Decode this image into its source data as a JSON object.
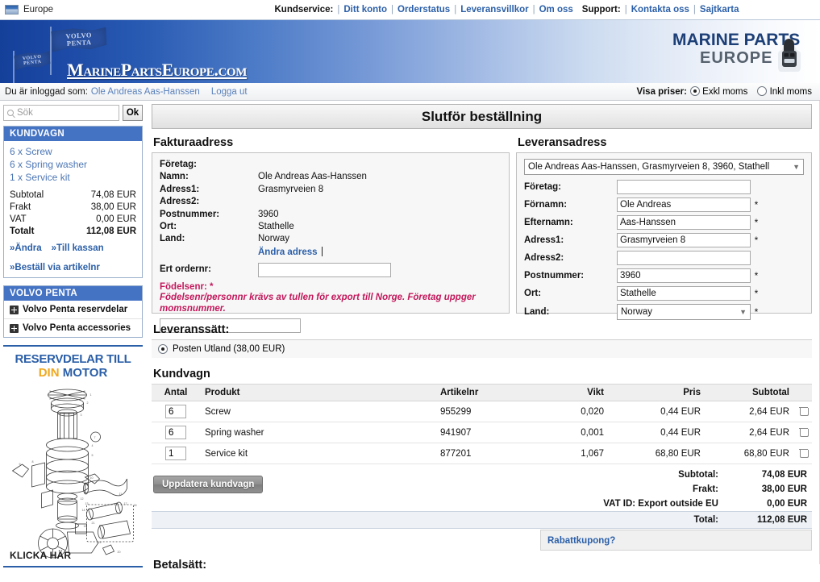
{
  "topbar": {
    "region": "Europe",
    "customer_service_label": "Kundservice:",
    "customer_links": [
      "Ditt konto",
      "Orderstatus",
      "Leveransvillkor",
      "Om oss"
    ],
    "support_label": "Support:",
    "support_links": [
      "Kontakta oss",
      "Sajtkarta"
    ]
  },
  "masthead": {
    "flag_text_line1": "VOLVO",
    "flag_text_line2": "PENTA",
    "wordmark": "MarinePartsEurope.com",
    "logo_line1": "MARINE PARTS",
    "logo_line2": "EUROPE"
  },
  "loginbar": {
    "logged_in_label": "Du är inloggad som:",
    "user_name": "Ole Andreas Aas-Hanssen",
    "logout_label": "Logga ut",
    "show_prices_label": "Visa priser:",
    "price_option_excl": "Exkl moms",
    "price_option_incl": "Inkl moms",
    "price_selected": "Exkl moms"
  },
  "sidebar": {
    "search_placeholder": "Sök",
    "search_value": "",
    "search_button": "Ok",
    "cart_panel": {
      "title": "KUNDVAGN",
      "lines": [
        "6 x Screw",
        "6 x Spring washer",
        "1 x Service kit"
      ],
      "totals": [
        {
          "label": "Subtotal",
          "value": "74,08 EUR"
        },
        {
          "label": "Frakt",
          "value": "38,00 EUR"
        },
        {
          "label": "VAT",
          "value": "0,00 EUR"
        },
        {
          "label": "Totalt",
          "value": "112,08 EUR"
        }
      ],
      "action_edit": "»Ändra",
      "action_checkout": "»Till kassan",
      "action_order_by_partno": "»Beställ via artikelnr"
    },
    "volvo_panel": {
      "title": "VOLVO PENTA",
      "items": [
        {
          "label": "Volvo Penta reservdelar"
        },
        {
          "label": "Volvo Penta accessories"
        }
      ]
    },
    "promo": {
      "line1": "RESERVDELAR TILL",
      "line2_a": "DIN",
      "line2_b": "MOTOR",
      "cta": "KLICKA HÄR"
    }
  },
  "main": {
    "page_title": "Slutför beställning",
    "billing": {
      "heading": "Fakturaadress",
      "rows": [
        {
          "label": "Företag:",
          "value": ""
        },
        {
          "label": "Namn:",
          "value": "Ole Andreas Aas-Hanssen"
        },
        {
          "label": "Adress1:",
          "value": "Grasmyrveien 8"
        },
        {
          "label": "Adress2:",
          "value": ""
        },
        {
          "label": "Postnummer:",
          "value": "3960"
        },
        {
          "label": "Ort:",
          "value": "Stathelle"
        },
        {
          "label": "Land:",
          "value": "Norway"
        }
      ],
      "change_address_link": "Ändra adress",
      "order_no_label": "Ert ordernr:",
      "order_no_value": "",
      "birth_label": "Födelsenr: *",
      "birth_warning": "Födelsenr/personnr krävs av tullen för export till Norge. Företag uppger momsnummer.",
      "birth_value": ""
    },
    "delivery": {
      "heading": "Leveransadress",
      "selected_address": "Ole Andreas Aas-Hanssen, Grasmyrveien 8, 3960, Stathell",
      "fields": [
        {
          "label": "Företag:",
          "value": "",
          "required": "",
          "type": "text"
        },
        {
          "label": "Förnamn:",
          "value": "Ole Andreas",
          "required": "*",
          "type": "text"
        },
        {
          "label": "Efternamn:",
          "value": "Aas-Hanssen",
          "required": "*",
          "type": "text"
        },
        {
          "label": "Adress1:",
          "value": "Grasmyrveien 8",
          "required": "*",
          "type": "text"
        },
        {
          "label": "Adress2:",
          "value": "",
          "required": "",
          "type": "text"
        },
        {
          "label": "Postnummer:",
          "value": "3960",
          "required": "*",
          "type": "text"
        },
        {
          "label": "Ort:",
          "value": "Stathelle",
          "required": "*",
          "type": "text"
        },
        {
          "label": "Land:",
          "value": "Norway",
          "required": "*",
          "type": "select"
        }
      ]
    },
    "shipping": {
      "heading": "Leveranssätt:",
      "option_label": "Posten Utland (38,00 EUR)",
      "selected": true
    },
    "cart": {
      "heading": "Kundvagn",
      "columns": [
        "Antal",
        "Produkt",
        "Artikelnr",
        "Vikt",
        "Pris",
        "Subtotal"
      ],
      "rows": [
        {
          "qty": "6",
          "product": "Screw",
          "partno": "955299",
          "weight": "0,020",
          "price": "0,44 EUR",
          "subtotal": "2,64 EUR"
        },
        {
          "qty": "6",
          "product": "Spring washer",
          "partno": "941907",
          "weight": "0,001",
          "price": "0,44 EUR",
          "subtotal": "2,64 EUR"
        },
        {
          "qty": "1",
          "product": "Service kit",
          "partno": "877201",
          "weight": "1,067",
          "price": "68,80 EUR",
          "subtotal": "68,80 EUR"
        }
      ],
      "update_button": "Uppdatera kundvagn",
      "totals": [
        {
          "label": "Subtotal:",
          "value": "74,08 EUR"
        },
        {
          "label": "Frakt:",
          "value": "38,00 EUR"
        },
        {
          "label": "VAT ID: Export outside EU",
          "value": "0,00 EUR"
        }
      ],
      "grand_total_label": "Total:",
      "grand_total_value": "112,08 EUR",
      "coupon_link": "Rabattkupong?"
    },
    "payment_heading": "Betalsätt:"
  }
}
